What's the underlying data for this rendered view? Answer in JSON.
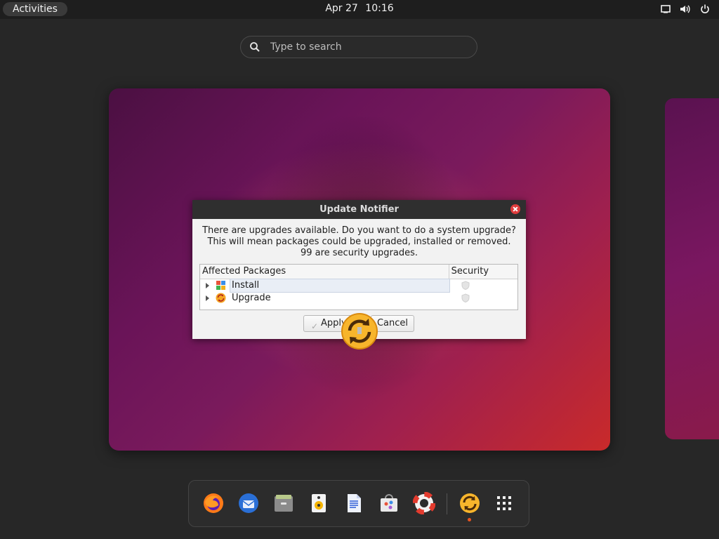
{
  "topbar": {
    "activities_label": "Activities",
    "date": "Apr 27",
    "time": "10:16",
    "tray_icons": [
      "display-icon",
      "volume-icon",
      "power-icon"
    ]
  },
  "search": {
    "placeholder": "Type to search"
  },
  "dialog": {
    "title": "Update Notifier",
    "message_lines": [
      "There are upgrades available. Do you want to do a system upgrade?",
      "This will mean packages could be upgraded, installed or removed.",
      "99 are security upgrades."
    ],
    "columns": [
      "Affected Packages",
      "Security"
    ],
    "rows": [
      {
        "label": "Install",
        "icon": "package-install-icon",
        "selected": true
      },
      {
        "label": "Upgrade",
        "icon": "package-upgrade-icon",
        "selected": false
      }
    ],
    "apply_label": "Apply",
    "cancel_label": "Cancel"
  },
  "dock": {
    "apps": [
      "firefox-icon",
      "thunderbird-icon",
      "files-icon",
      "rhythmbox-icon",
      "writer-icon",
      "software-icon",
      "help-icon",
      "update-notifier-icon",
      "app-grid-icon"
    ]
  },
  "colors": {
    "accent": "#e95420",
    "close": "#e03c3c",
    "wallpaper_start": "#4b1042",
    "wallpaper_end": "#c92a2a"
  }
}
